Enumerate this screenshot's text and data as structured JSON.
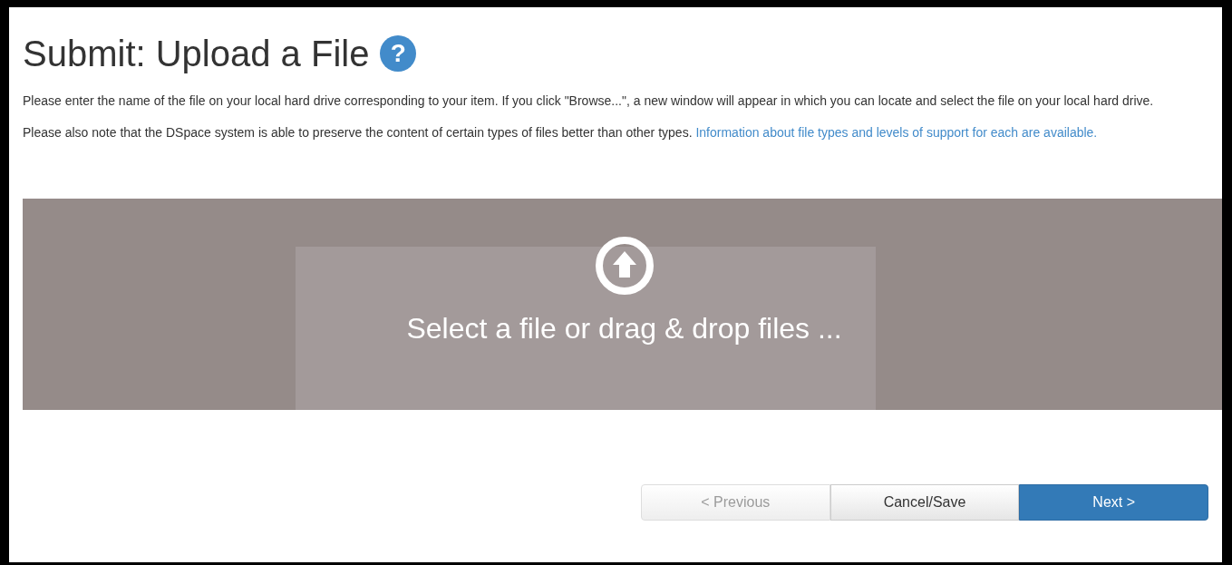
{
  "heading": {
    "title": "Submit: Upload a File",
    "help_icon": "?"
  },
  "paragraphs": [
    {
      "text": "Please enter the name of the file on your local hard drive corresponding to your item. If you click \"Browse...\", a new window will appear in which you can locate and select the file on your local hard drive."
    },
    {
      "text": "Please also note that the DSpace system is able to preserve the content of certain types of files better than other types.",
      "link": "Information about file types and levels of support for each are available."
    }
  ],
  "dropzone": {
    "label": "Select a file or drag & drop files ..."
  },
  "buttons": [
    {
      "label": "< Previous",
      "kind": "default",
      "disabled": true
    },
    {
      "label": "Cancel/Save",
      "kind": "default",
      "disabled": false
    },
    {
      "label": "Next >",
      "kind": "primary",
      "disabled": false
    }
  ]
}
